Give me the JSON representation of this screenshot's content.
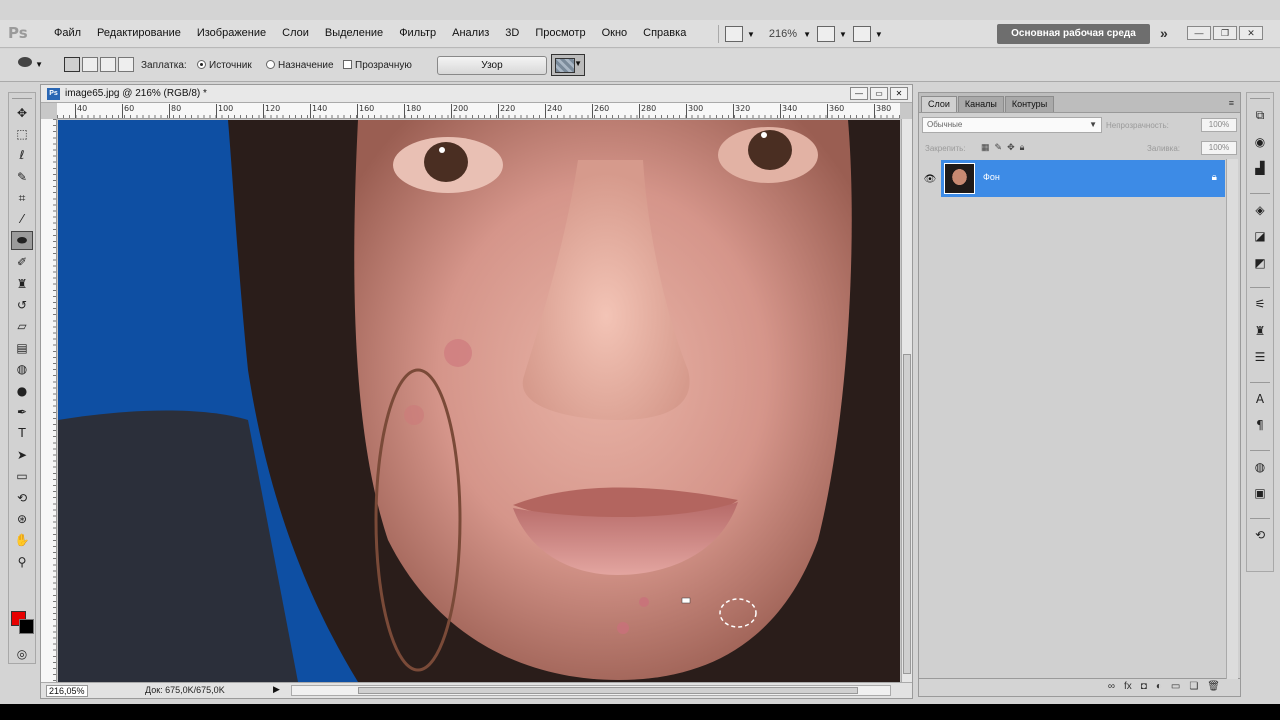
{
  "menubar": {
    "logo": "Ps",
    "items": [
      "Файл",
      "Редактирование",
      "Изображение",
      "Слои",
      "Выделение",
      "Фильтр",
      "Анализ",
      "3D",
      "Просмотр",
      "Окно",
      "Справка"
    ],
    "zoom": "216%",
    "workspace": "Основная рабочая среда"
  },
  "options": {
    "patch_label": "Заплатка:",
    "source_label": "Источник",
    "source_checked": true,
    "destination_label": "Назначение",
    "transparent_label": "Прозрачную",
    "use_pattern_button": "Узор"
  },
  "toolbox": {
    "tools": [
      "move-icon",
      "marquee-icon",
      "lasso-icon",
      "quick-select-icon",
      "crop-icon",
      "eyedropper-icon",
      "patch-tool-icon",
      "brush-icon",
      "clone-stamp-icon",
      "history-brush-icon",
      "eraser-icon",
      "gradient-icon",
      "blur-icon",
      "dodge-icon",
      "pen-icon",
      "type-icon",
      "path-select-icon",
      "rectangle-icon",
      "3d-rotate-icon",
      "3d-orbit-icon",
      "hand-icon",
      "zoom-icon"
    ],
    "active_tool": "patch-tool-icon",
    "foreground_color": "#e60000",
    "background_color": "#000000"
  },
  "document": {
    "title": "image65.jpg @ 216% (RGB/8) *",
    "ruler_ticks": [
      "40",
      "60",
      "80",
      "100",
      "120",
      "140",
      "160",
      "180",
      "200",
      "220",
      "240",
      "260",
      "280",
      "300",
      "320",
      "340",
      "360",
      "380"
    ],
    "zoom_field": "216,05%",
    "doc_info": "Док: 675,0K/675,0K"
  },
  "layers_panel": {
    "tabs": [
      "Слои",
      "Каналы",
      "Контуры"
    ],
    "active_tab": "Слои",
    "blend_mode": "Обычные",
    "opacity_label": "Непрозрачность:",
    "opacity_value": "100%",
    "lock_label": "Закрепить:",
    "fill_label": "Заливка:",
    "fill_value": "100%",
    "layers": [
      {
        "name": "Фон",
        "visible": true,
        "locked": true,
        "selected": true
      }
    ],
    "footer_icons": [
      "link-icon",
      "fx-icon",
      "mask-icon",
      "adjustment-icon",
      "group-icon",
      "new-layer-icon",
      "trash-icon"
    ]
  },
  "dock": {
    "icons": [
      "navigator-icon",
      "color-wheel-icon",
      "histogram-icon",
      "styles-icon",
      "adjustments-icon",
      "masks-icon",
      "brushes-icon",
      "clone-source-icon",
      "layers-stack-icon",
      "character-icon",
      "paragraph-icon",
      "tool-presets-icon",
      "actions-icon",
      "paths-icon"
    ]
  },
  "colors": {
    "accent": "#3d8be6",
    "canvas_bg": "#0e4fa3"
  }
}
